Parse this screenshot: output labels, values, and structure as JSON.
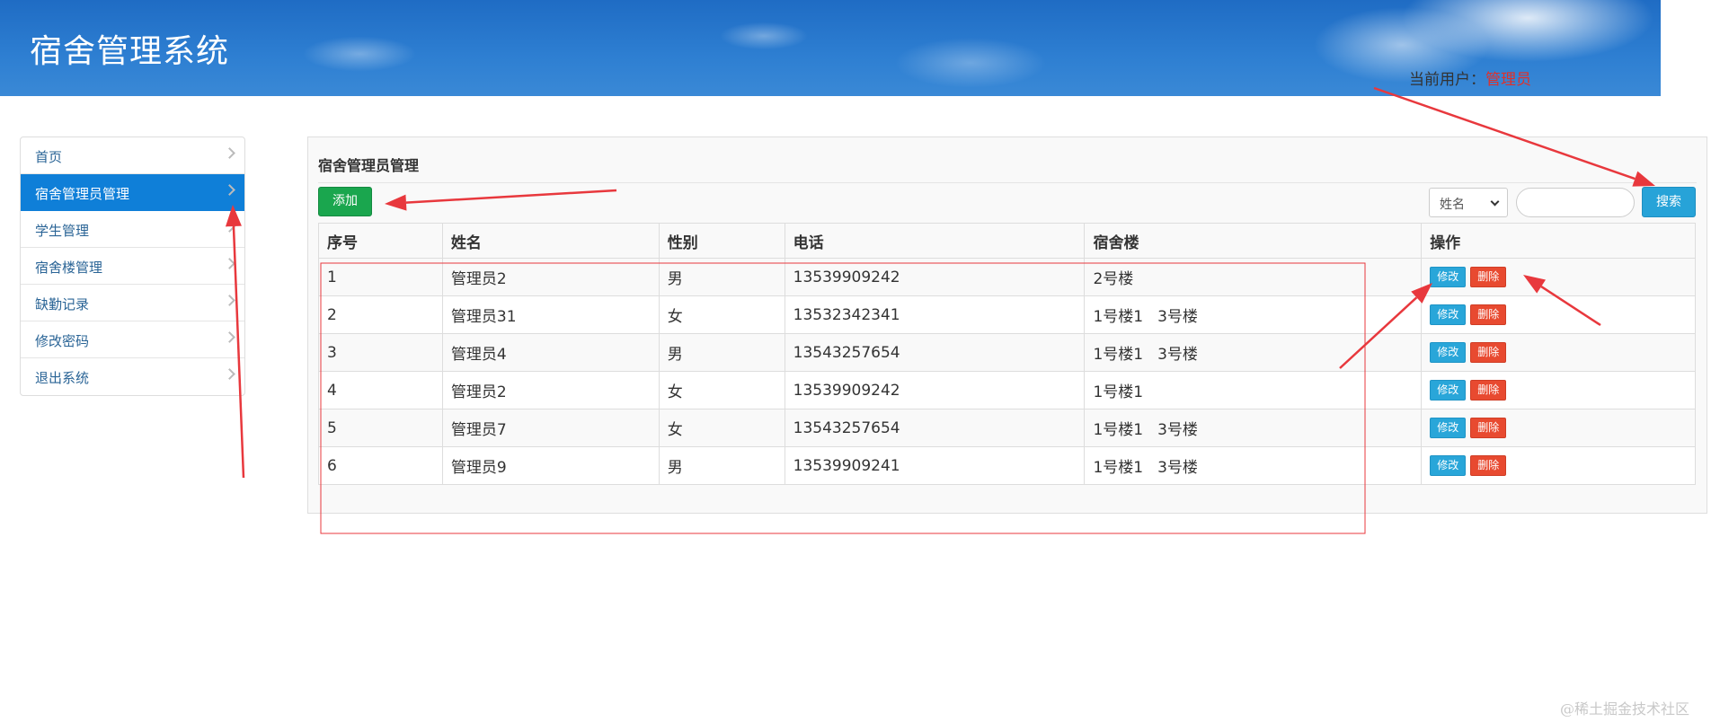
{
  "header": {
    "app_title": "宿舍管理系统",
    "user_label": "当前用户：",
    "user_value": "管理员"
  },
  "sidebar": {
    "items": [
      {
        "label": "首页",
        "active": false
      },
      {
        "label": "宿舍管理员管理",
        "active": true
      },
      {
        "label": "学生管理",
        "active": false
      },
      {
        "label": "宿舍楼管理",
        "active": false
      },
      {
        "label": "缺勤记录",
        "active": false
      },
      {
        "label": "修改密码",
        "active": false
      },
      {
        "label": "退出系统",
        "active": false
      }
    ]
  },
  "panel": {
    "title": "宿舍管理员管理",
    "add_label": "添加",
    "search_field_selected": "姓名",
    "search_value": "",
    "search_label": "搜索"
  },
  "table": {
    "headers": [
      "序号",
      "姓名",
      "性别",
      "电话",
      "宿舍楼",
      "操作"
    ],
    "rows": [
      {
        "id": "1",
        "name": "管理员2",
        "gender": "男",
        "phone": "13539909242",
        "buildings": [
          "2号楼"
        ]
      },
      {
        "id": "2",
        "name": "管理员31",
        "gender": "女",
        "phone": "13532342341",
        "buildings": [
          "1号楼1",
          "3号楼"
        ]
      },
      {
        "id": "3",
        "name": "管理员4",
        "gender": "男",
        "phone": "13543257654",
        "buildings": [
          "1号楼1",
          "3号楼"
        ]
      },
      {
        "id": "4",
        "name": "管理员2",
        "gender": "女",
        "phone": "13539909242",
        "buildings": [
          "1号楼1"
        ]
      },
      {
        "id": "5",
        "name": "管理员7",
        "gender": "女",
        "phone": "13543257654",
        "buildings": [
          "1号楼1",
          "3号楼"
        ]
      },
      {
        "id": "6",
        "name": "管理员9",
        "gender": "男",
        "phone": "13539909241",
        "buildings": [
          "1号楼1",
          "3号楼"
        ]
      }
    ],
    "edit_label": "修改",
    "delete_label": "删除"
  },
  "annotation_color": "#e8383d",
  "watermark": "@稀土掘金技术社区"
}
